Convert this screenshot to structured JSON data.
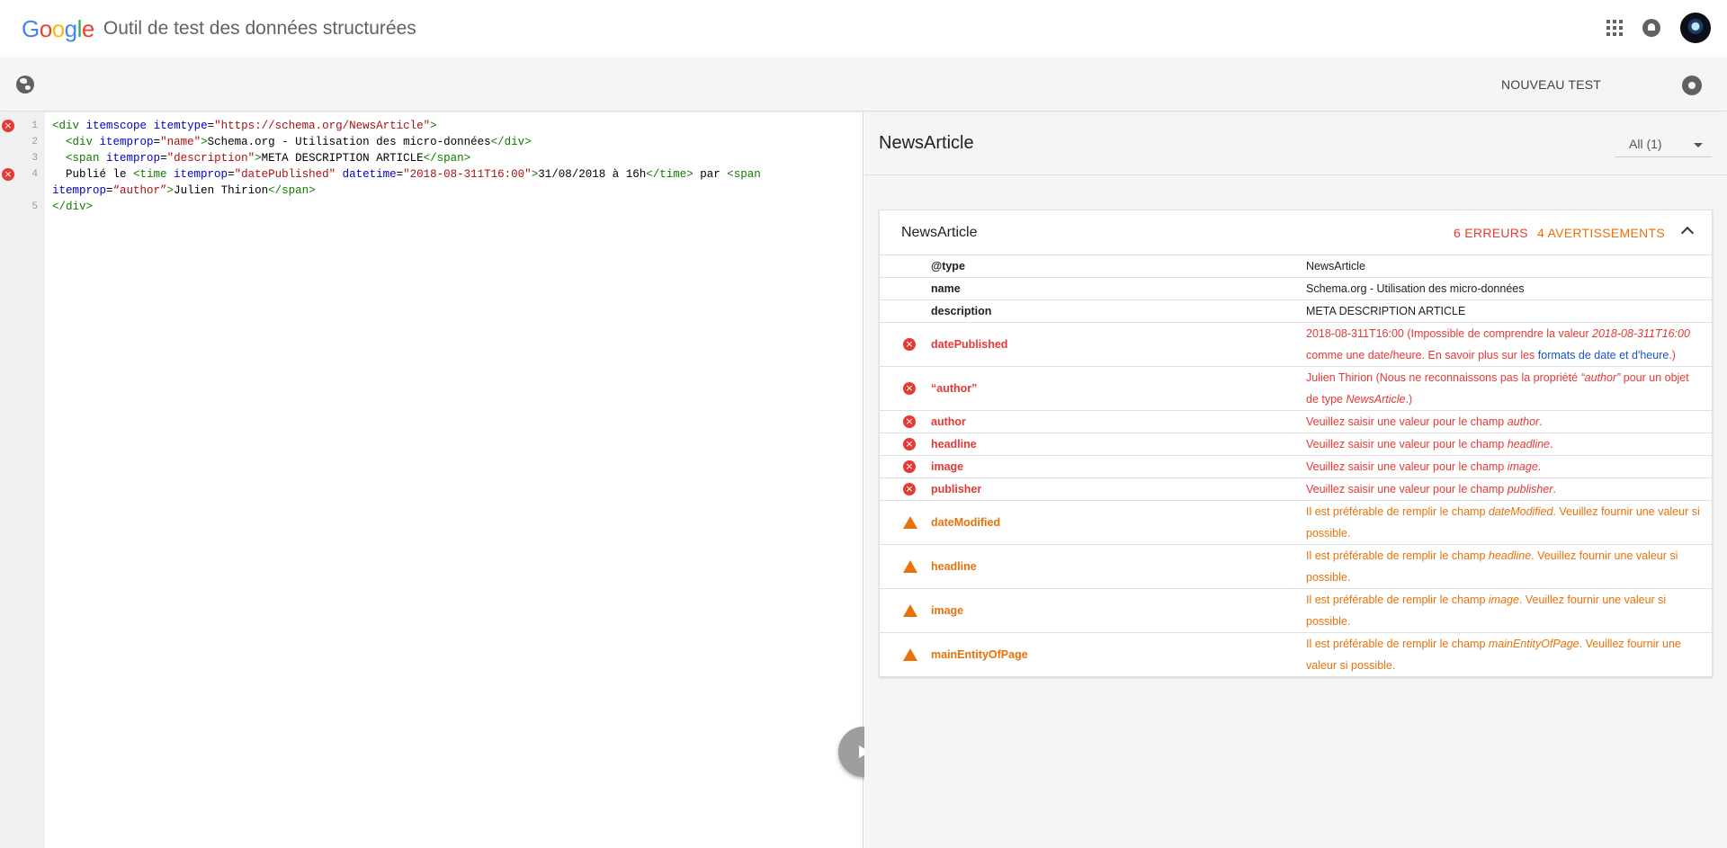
{
  "header": {
    "logo_letters": [
      {
        "ch": "G",
        "color": "#4285F4"
      },
      {
        "ch": "o",
        "color": "#EA4335"
      },
      {
        "ch": "o",
        "color": "#FBBC05"
      },
      {
        "ch": "g",
        "color": "#4285F4"
      },
      {
        "ch": "l",
        "color": "#34A853"
      },
      {
        "ch": "e",
        "color": "#EA4335"
      }
    ],
    "app_title": "Outil de test des données structurées",
    "icons": [
      "apps-icon",
      "notifications-icon",
      "avatar"
    ]
  },
  "toolbar": {
    "new_test_label": "NOUVEAU TEST",
    "icons": [
      "globe-icon",
      "settings-icon"
    ]
  },
  "editor": {
    "lines": [
      {
        "num": "1",
        "error": true,
        "html": "<span class=\"t\">&lt;div</span> <span class=\"a\">itemscope</span> <span class=\"a\">itemtype</span>=<span class=\"s\">\"https://schema.org/NewsArticle\"</span><span class=\"t\">&gt;</span>"
      },
      {
        "num": "2",
        "error": false,
        "html": "  <span class=\"t\">&lt;div</span> <span class=\"a\">itemprop</span>=<span class=\"s\">\"name\"</span><span class=\"t\">&gt;</span>Schema.org - Utilisation des micro-données<span class=\"t\">&lt;/div&gt;</span>"
      },
      {
        "num": "3",
        "error": false,
        "html": "  <span class=\"t\">&lt;span</span> <span class=\"a\">itemprop</span>=<span class=\"s\">\"description\"</span><span class=\"t\">&gt;</span>META DESCRIPTION ARTICLE<span class=\"t\">&lt;/span&gt;</span>"
      },
      {
        "num": "4",
        "error": true,
        "html": "  Publié le <span class=\"t\">&lt;time</span> <span class=\"a\">itemprop</span>=<span class=\"s\">\"datePublished\"</span> <span class=\"a\">datetime</span>=<span class=\"s\">\"2018-08-311T16:00\"</span><span class=\"t\">&gt;</span>31/08/2018 à 16h<span class=\"t\">&lt;/time&gt;</span> par <span class=\"t\">&lt;span</span>"
      },
      {
        "num": "",
        "error": false,
        "html": "<span class=\"a\">itemprop</span>=<span class=\"s\">“author”</span><span class=\"t\">&gt;</span>Julien Thirion<span class=\"t\">&lt;/span&gt;</span>"
      },
      {
        "num": "5",
        "error": false,
        "html": "<span class=\"t\">&lt;/div&gt;</span>"
      }
    ]
  },
  "results": {
    "title": "NewsArticle",
    "filter_label": "All (1)",
    "card": {
      "title": "NewsArticle",
      "errors_label": "6 ERREURS",
      "warnings_label": "4 AVERTISSEMENTS",
      "rows": [
        {
          "status": "ok",
          "key": "@type",
          "value_html": "NewsArticle"
        },
        {
          "status": "ok",
          "key": "name",
          "value_html": "Schema.org - Utilisation des micro-données"
        },
        {
          "status": "ok",
          "key": "description",
          "value_html": "META DESCRIPTION ARTICLE"
        },
        {
          "status": "err",
          "key": "datePublished",
          "value_html": "2018-08-311T16:00 (Impossible de comprendre la valeur <em>2018-08-311T16:00</em> comme une date/heure. En savoir plus sur les <a>formats de date et d'heure</a>.)"
        },
        {
          "status": "err",
          "key": "“author”",
          "value_html": "Julien Thirion (Nous ne reconnaissons pas la propriété <em>“author”</em> pour un objet de type <em>NewsArticle</em>.)"
        },
        {
          "status": "err",
          "key": "author",
          "value_html": "Veuillez saisir une valeur pour le champ <em>author</em>."
        },
        {
          "status": "err",
          "key": "headline",
          "value_html": "Veuillez saisir une valeur pour le champ <em>headline</em>."
        },
        {
          "status": "err",
          "key": "image",
          "value_html": "Veuillez saisir une valeur pour le champ <em>image</em>."
        },
        {
          "status": "err",
          "key": "publisher",
          "value_html": "Veuillez saisir une valeur pour le champ <em>publisher</em>."
        },
        {
          "status": "warn",
          "key": "dateModified",
          "value_html": "Il est préférable de remplir le champ <em>dateModified</em>. Veuillez fournir une valeur si possible."
        },
        {
          "status": "warn",
          "key": "headline",
          "value_html": "Il est préférable de remplir le champ <em>headline</em>. Veuillez fournir une valeur si possible."
        },
        {
          "status": "warn",
          "key": "image",
          "value_html": "Il est préférable de remplir le champ <em>image</em>. Veuillez fournir une valeur si possible."
        },
        {
          "status": "warn",
          "key": "mainEntityOfPage",
          "value_html": "Il est préférable de remplir le champ <em>mainEntityOfPage</em>. Veuillez fournir une valeur si possible."
        }
      ]
    }
  },
  "colors": {
    "error": "#e53935",
    "warning": "#e8710a",
    "link": "#1a56c6"
  }
}
